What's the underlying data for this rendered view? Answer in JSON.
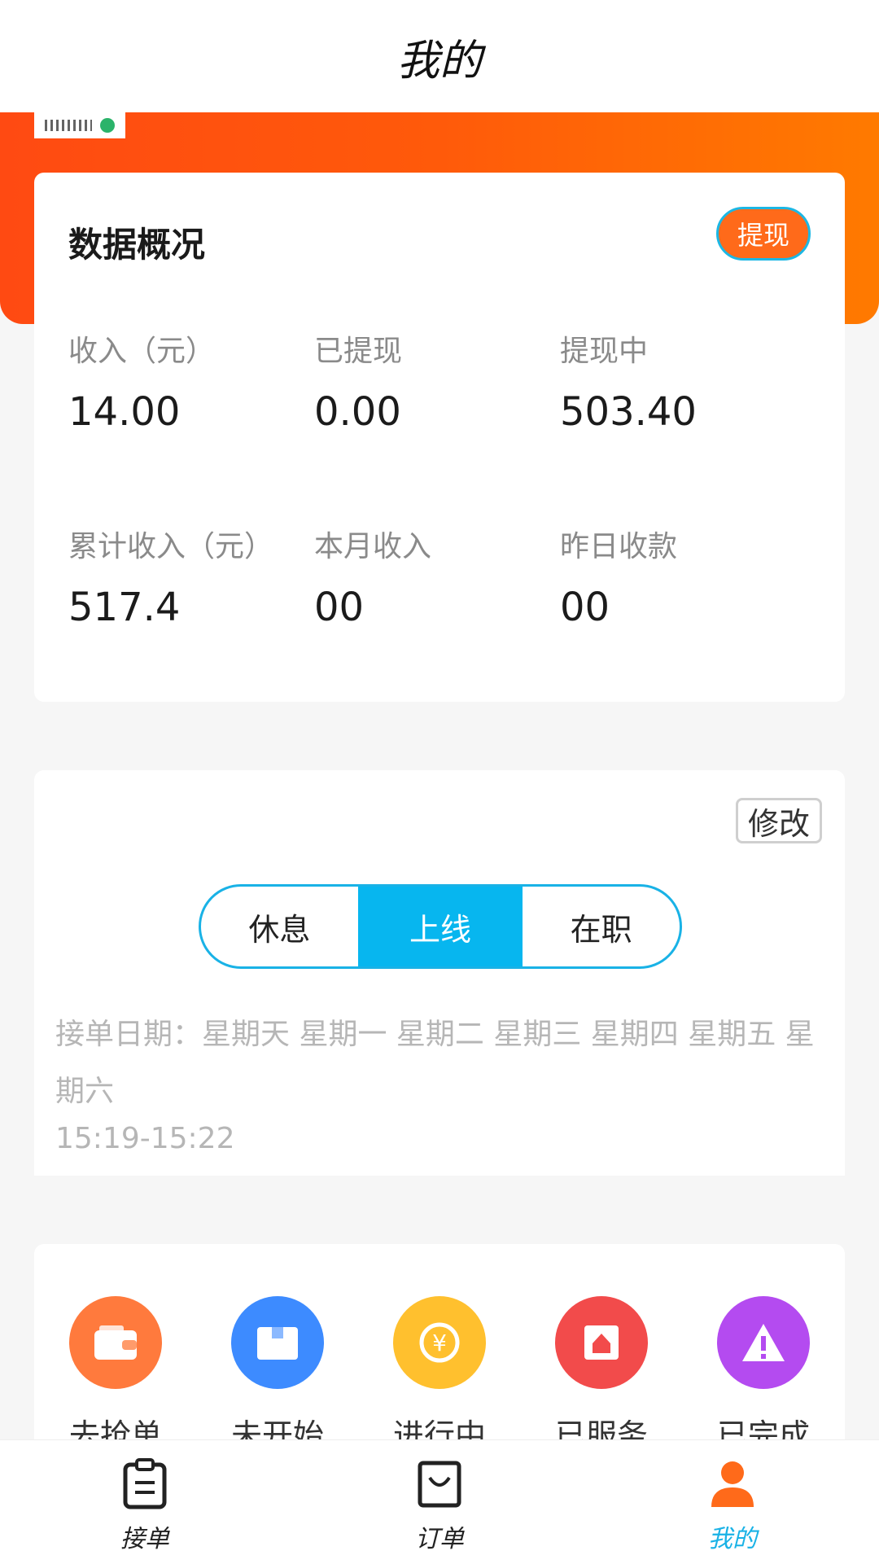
{
  "header": {
    "title": "我的"
  },
  "overview": {
    "title": "数据概况",
    "withdraw_button": "提现",
    "stats": [
      {
        "label": "收入（元）",
        "value": "14.00"
      },
      {
        "label": "已提现",
        "value": "0.00"
      },
      {
        "label": "提现中",
        "value": "503.40"
      },
      {
        "label": "累计收入（元）",
        "value": "517.4"
      },
      {
        "label": "本月收入",
        "value": "00"
      },
      {
        "label": "昨日收款",
        "value": "00"
      }
    ]
  },
  "schedule": {
    "modify_button": "修改",
    "status_options": [
      "休息",
      "上线",
      "在职"
    ],
    "selected_status": "上线",
    "days_text": "接单日期：星期天 星期一 星期二 星期三 星期四 星期五 星期六",
    "time_text": "15:19-15:22"
  },
  "orders": {
    "items": [
      {
        "label": "去抢单",
        "icon": "wallet-icon",
        "color": "#ff7a3d"
      },
      {
        "label": "未开始",
        "icon": "box-icon",
        "color": "#3d8bff"
      },
      {
        "label": "进行中",
        "icon": "yuan-cycle-icon",
        "color": "#ffc02e"
      },
      {
        "label": "已服务",
        "icon": "home-alert-icon",
        "color": "#f24b4b"
      },
      {
        "label": "已完成",
        "icon": "warning-icon",
        "color": "#b44bf0"
      }
    ]
  },
  "tabbar": {
    "items": [
      {
        "label": "接单",
        "icon": "clipboard-icon"
      },
      {
        "label": "订单",
        "icon": "bag-icon"
      },
      {
        "label": "我的",
        "icon": "user-icon",
        "active": true
      }
    ]
  },
  "colors": {
    "accent_orange": "#ff5a0a",
    "accent_blue": "#07b6ef"
  }
}
